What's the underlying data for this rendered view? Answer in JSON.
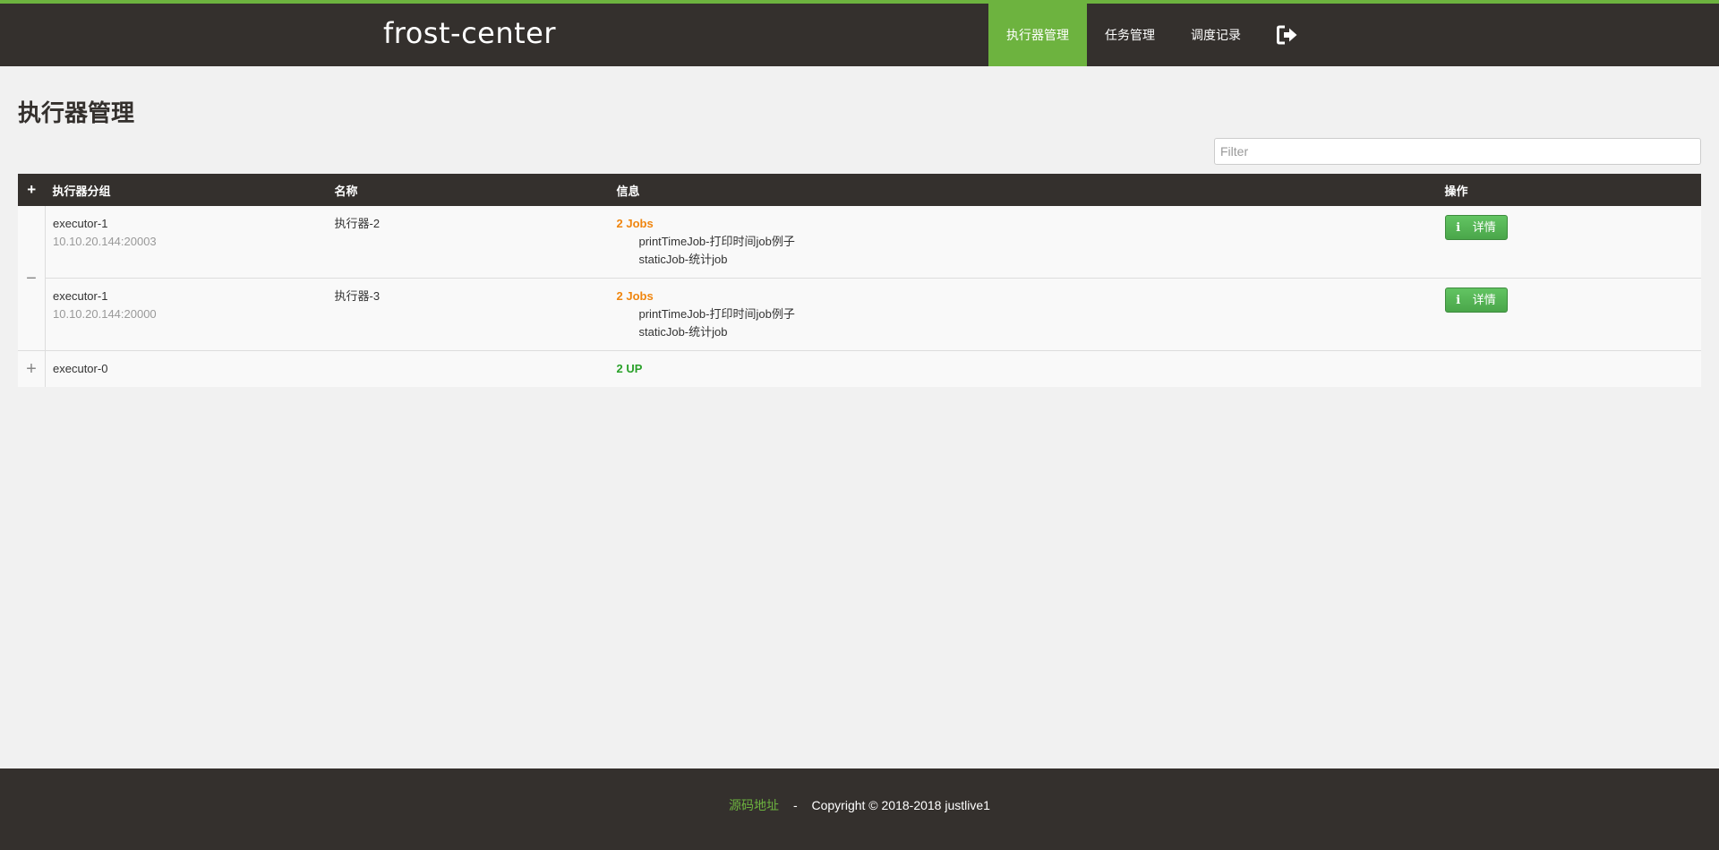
{
  "app": {
    "brand": "frost-center"
  },
  "nav": {
    "items": [
      {
        "label": "执行器管理",
        "active": true
      },
      {
        "label": "任务管理"
      },
      {
        "label": "调度记录"
      }
    ],
    "logout_icon": "sign-out-icon"
  },
  "page": {
    "title": "执行器管理"
  },
  "filter": {
    "placeholder": "Filter",
    "value": ""
  },
  "table": {
    "expand_all_symbol": "+",
    "headers": [
      "执行器分组",
      "名称",
      "信息",
      "操作"
    ],
    "groups": [
      {
        "toggle_symbol": "−",
        "expanded": true,
        "rows": [
          {
            "group": "executor-1",
            "address": "10.10.20.144:20003",
            "name": "执行器-2",
            "info_summary": "2 Jobs",
            "jobs": [
              "printTimeJob-打印时间job例子",
              "staticJob-统计job"
            ],
            "action_icon": "i",
            "action_label": "详情"
          },
          {
            "group": "executor-1",
            "address": "10.10.20.144:20000",
            "name": "执行器-3",
            "info_summary": "2 Jobs",
            "jobs": [
              "printTimeJob-打印时间job例子",
              "staticJob-统计job"
            ],
            "action_icon": "i",
            "action_label": "详情"
          }
        ]
      },
      {
        "toggle_symbol": "+",
        "expanded": false,
        "group": "executor-0",
        "status": "2 UP"
      }
    ]
  },
  "footer": {
    "source_link": "源码地址",
    "separator": "-",
    "copyright": "Copyright © 2018-2018 justlive1"
  },
  "colors": {
    "navbar_bg": "#34302d",
    "accent_green": "#6db33f",
    "jobs_orange": "#f0860f",
    "status_green": "#2aa12a",
    "button_green": "#5cb85c",
    "page_bg": "#f1f1f1"
  }
}
